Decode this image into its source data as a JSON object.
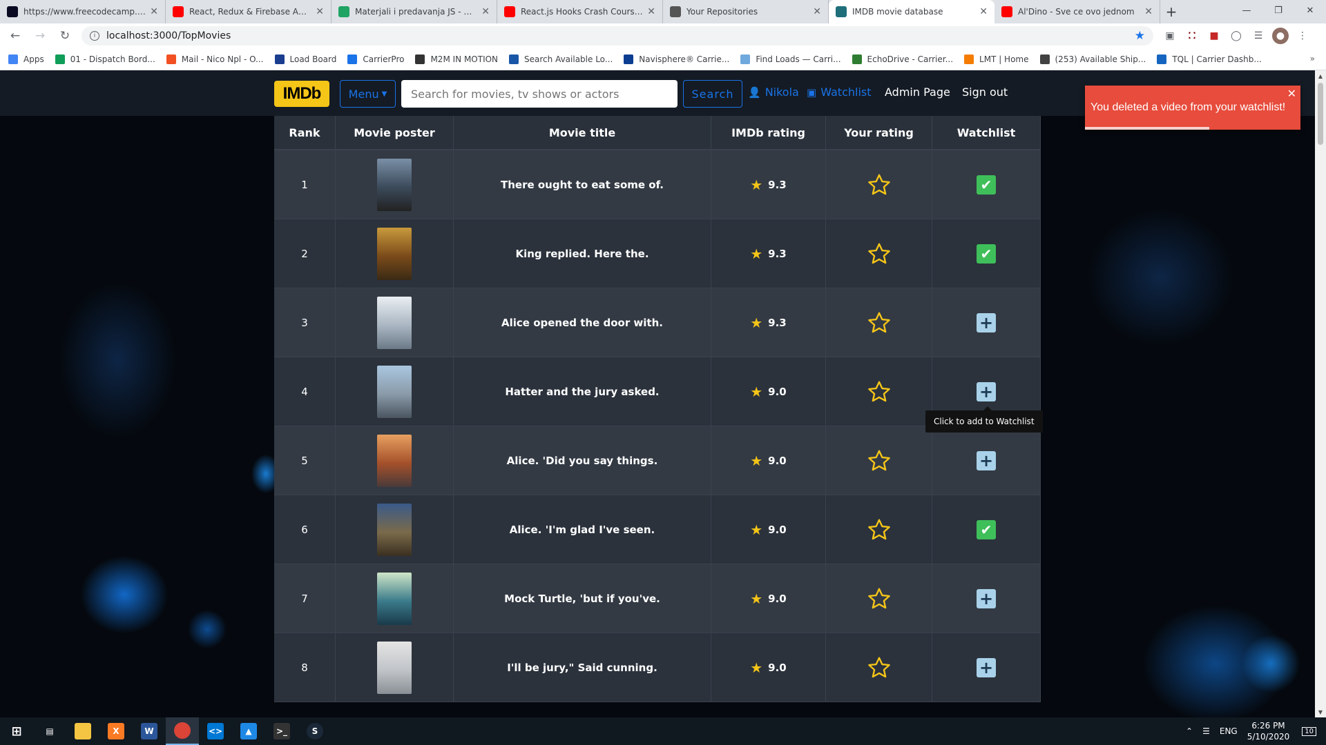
{
  "browser": {
    "tabs": [
      {
        "title": "https://www.freecodecamp.org/l",
        "favicon_color": "#0a0a23",
        "active": false
      },
      {
        "title": "React, Redux & Firebase App Tut",
        "favicon_color": "#ff0000",
        "active": false
      },
      {
        "title": "Materjali i predavanja JS - Googl",
        "favicon_color": "#1fa463",
        "active": false
      },
      {
        "title": "React.js Hooks Crash Course - Yo",
        "favicon_color": "#ff0000",
        "active": false
      },
      {
        "title": "Your Repositories",
        "favicon_color": "#555555",
        "active": false
      },
      {
        "title": "IMDB movie database",
        "favicon_color": "#1e6f7a",
        "active": true
      },
      {
        "title": "Al'Dino - Sve ce ovo jednom",
        "favicon_color": "#ff0000",
        "active": false
      }
    ],
    "url": "localhost:3000/TopMovies",
    "bookmarks": [
      {
        "label": "Apps",
        "color": "#4285f4"
      },
      {
        "label": "01 - Dispatch Bord...",
        "color": "#0f9d58"
      },
      {
        "label": "Mail - Nico Npl - O...",
        "color": "#f25022"
      },
      {
        "label": "Load Board",
        "color": "#1a3d8f"
      },
      {
        "label": "CarrierPro",
        "color": "#1a73e8"
      },
      {
        "label": "M2M IN MOTION",
        "color": "#333333"
      },
      {
        "label": "Search Available Lo...",
        "color": "#1a56a8"
      },
      {
        "label": "Navisphere® Carrie...",
        "color": "#0b3d91"
      },
      {
        "label": "Find Loads — Carri...",
        "color": "#6fa8dc"
      },
      {
        "label": "EchoDrive - Carrier...",
        "color": "#2e7d32"
      },
      {
        "label": "LMT | Home",
        "color": "#f57c00"
      },
      {
        "label": "(253) Available Ship...",
        "color": "#424242"
      },
      {
        "label": "TQL | Carrier Dashb...",
        "color": "#1565c0"
      }
    ]
  },
  "navbar": {
    "logo": "IMDb",
    "menu_label": "Menu",
    "search_placeholder": "Search for movies, tv shows or actors",
    "search_button": "Search",
    "user": "Nikola",
    "watchlist": "Watchlist",
    "admin": "Admin Page",
    "signout": "Sign out"
  },
  "table": {
    "headers": [
      "Rank",
      "Movie poster",
      "Movie title",
      "IMDb rating",
      "Your rating",
      "Watchlist"
    ],
    "rows": [
      {
        "rank": "1",
        "title": "There ought to eat some of.",
        "rating": "9.3",
        "watchlist": "check",
        "poster": [
          "#7a8fa6",
          "#3b4a5a",
          "#222"
        ]
      },
      {
        "rank": "2",
        "title": "King replied. Here the.",
        "rating": "9.3",
        "watchlist": "check",
        "poster": [
          "#c99a3c",
          "#7a4a1a",
          "#3a2a14"
        ]
      },
      {
        "rank": "3",
        "title": "Alice opened the door with.",
        "rating": "9.3",
        "watchlist": "plus",
        "poster": [
          "#e9eef2",
          "#aab6c2",
          "#6c7a88"
        ]
      },
      {
        "rank": "4",
        "title": "Hatter and the jury asked.",
        "rating": "9.0",
        "watchlist": "plus",
        "poster": [
          "#a9c6e0",
          "#8a9aa8",
          "#4a5560"
        ]
      },
      {
        "rank": "5",
        "title": "Alice. 'Did you say things.",
        "rating": "9.0",
        "watchlist": "plus",
        "poster": [
          "#e8a060",
          "#a4502a",
          "#4a3a3a"
        ]
      },
      {
        "rank": "6",
        "title": "Alice. 'I'm glad I've seen.",
        "rating": "9.0",
        "watchlist": "check",
        "poster": [
          "#3a5a8a",
          "#7a6a4a",
          "#3a3020"
        ]
      },
      {
        "rank": "7",
        "title": "Mock Turtle, 'but if you've.",
        "rating": "9.0",
        "watchlist": "plus",
        "poster": [
          "#cfe6c8",
          "#3a7a8a",
          "#1a3a4a"
        ]
      },
      {
        "rank": "8",
        "title": "I'll be jury,\" Said cunning.",
        "rating": "9.0",
        "watchlist": "plus",
        "poster": [
          "#e4e4e4",
          "#c0c4c8",
          "#8a9096"
        ]
      }
    ]
  },
  "tooltip": "Click to add to Watchlist",
  "toast": "You deleted a video from your watchlist!",
  "taskbar": {
    "language": "ENG",
    "time": "6:26 PM",
    "date": "5/10/2020",
    "notifications": "10"
  }
}
